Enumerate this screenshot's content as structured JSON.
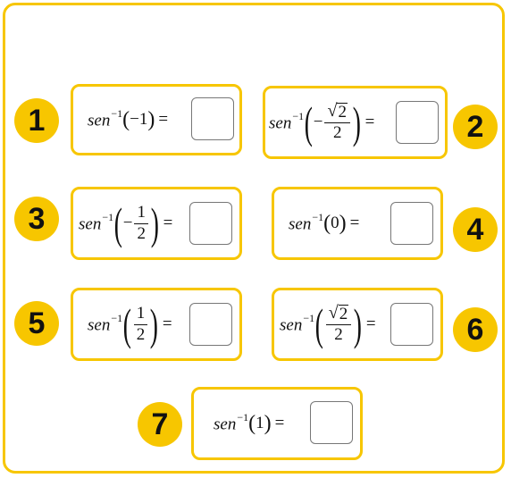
{
  "accent_color": "#f7c600",
  "function_name": "sen",
  "inverse_exponent": "−1",
  "equals_sign": "=",
  "exercises": [
    {
      "number": "1",
      "argument": "−1"
    },
    {
      "number": "2",
      "sign": "−",
      "numerator": "2",
      "denominator": "2",
      "numerator_is_root": true
    },
    {
      "number": "3",
      "sign": "−",
      "numerator": "1",
      "denominator": "2"
    },
    {
      "number": "4",
      "argument": "0"
    },
    {
      "number": "5",
      "numerator": "1",
      "denominator": "2"
    },
    {
      "number": "6",
      "numerator": "2",
      "denominator": "2",
      "numerator_is_root": true
    },
    {
      "number": "7",
      "argument": "1"
    }
  ]
}
